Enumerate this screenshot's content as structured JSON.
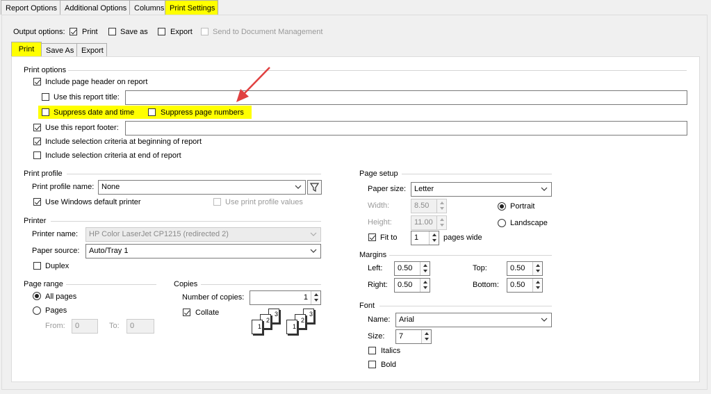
{
  "tabs": [
    "Report Options",
    "Additional Options",
    "Columns",
    "Print Settings"
  ],
  "output_options": {
    "label": "Output options:",
    "print": "Print",
    "save_as": "Save as",
    "export": "Export",
    "send_doc": "Send to Document Management"
  },
  "subtabs": [
    "Print",
    "Save As",
    "Export"
  ],
  "print_options": {
    "title": "Print options",
    "include_header": "Include page header on report",
    "use_title": "Use this report title:",
    "suppress_date": "Suppress date and time",
    "suppress_pages": "Suppress page numbers",
    "use_footer": "Use this report footer:",
    "include_begin": "Include selection criteria at beginning of report",
    "include_end": "Include selection criteria at end of report"
  },
  "print_profile": {
    "title": "Print profile",
    "name_label": "Print profile name:",
    "name_value": "None",
    "use_windows": "Use Windows default printer",
    "use_profile_values": "Use print profile values"
  },
  "printer": {
    "title": "Printer",
    "name_label": "Printer name:",
    "name_value": "HP Color LaserJet CP1215 (redirected 2)",
    "source_label": "Paper source:",
    "source_value": "Auto/Tray 1",
    "duplex": "Duplex"
  },
  "page_range": {
    "title": "Page range",
    "all": "All pages",
    "pages": "Pages",
    "from_label": "From:",
    "from_value": "0",
    "to_label": "To:",
    "to_value": "0"
  },
  "copies": {
    "title": "Copies",
    "number_label": "Number of copies:",
    "number_value": "1",
    "collate": "Collate",
    "collate_digits": [
      "1",
      "2",
      "3",
      "1",
      "2",
      "3"
    ]
  },
  "page_setup": {
    "title": "Page setup",
    "paper_size_label": "Paper size:",
    "paper_size_value": "Letter",
    "width_label": "Width:",
    "width_value": "8.50",
    "height_label": "Height:",
    "height_value": "11.00",
    "portrait": "Portrait",
    "landscape": "Landscape",
    "fit_to": "Fit to",
    "fit_value": "1",
    "pages_wide": "pages wide"
  },
  "margins": {
    "title": "Margins",
    "left_label": "Left:",
    "left_value": "0.50",
    "top_label": "Top:",
    "top_value": "0.50",
    "right_label": "Right:",
    "right_value": "0.50",
    "bottom_label": "Bottom:",
    "bottom_value": "0.50"
  },
  "font": {
    "title": "Font",
    "name_label": "Name:",
    "name_value": "Arial",
    "size_label": "Size:",
    "size_value": "7",
    "italics": "Italics",
    "bold": "Bold"
  },
  "colors": {
    "highlight": "#ffff00",
    "arrow": "#e04040"
  }
}
